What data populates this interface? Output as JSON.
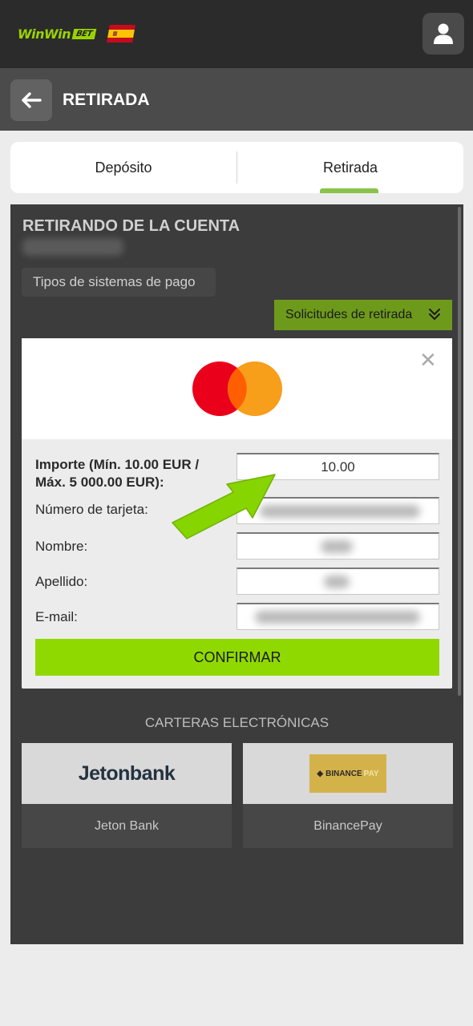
{
  "header": {
    "logo_text": "WinWin",
    "logo_badge": "BET",
    "flag_icon": "spain-flag-icon",
    "user_icon": "user-icon"
  },
  "titlebar": {
    "back_icon": "arrow-left-icon",
    "title": "RETIRADA"
  },
  "tabs": [
    {
      "label": "Depósito",
      "active": false
    },
    {
      "label": "Retirada",
      "active": true
    }
  ],
  "account": {
    "title": "RETIRANDO DE LA CUENTA",
    "payment_types_label": "Tipos de sistemas de pago",
    "requests_button_label": "Solicitudes de retirada"
  },
  "modal": {
    "card_brand_icon": "mastercard-icon",
    "close_icon": "close-icon",
    "fields": {
      "amount_label_line1": "Importe (Mín. 10.00 EUR /",
      "amount_label_line2": "Máx. 5 000.00 EUR):",
      "amount_value": "10.00",
      "card_number_label": "Número de tarjeta:",
      "first_name_label": "Nombre:",
      "last_name_label": "Apellido:",
      "email_label": "E-mail:"
    },
    "confirm_label": "CONFIRMAR"
  },
  "wallets": {
    "title": "CARTERAS ELECTRÓNICAS",
    "items": [
      {
        "logo_text": "Jetonbank",
        "name": "Jeton Bank"
      },
      {
        "logo_text": "BINANCE",
        "logo_suffix": "PAY",
        "name": "BinancePay"
      }
    ]
  },
  "colors": {
    "accent_green": "#8fd900",
    "dark_bg": "#2b2b2b",
    "panel_bg": "#3c3c3c"
  }
}
